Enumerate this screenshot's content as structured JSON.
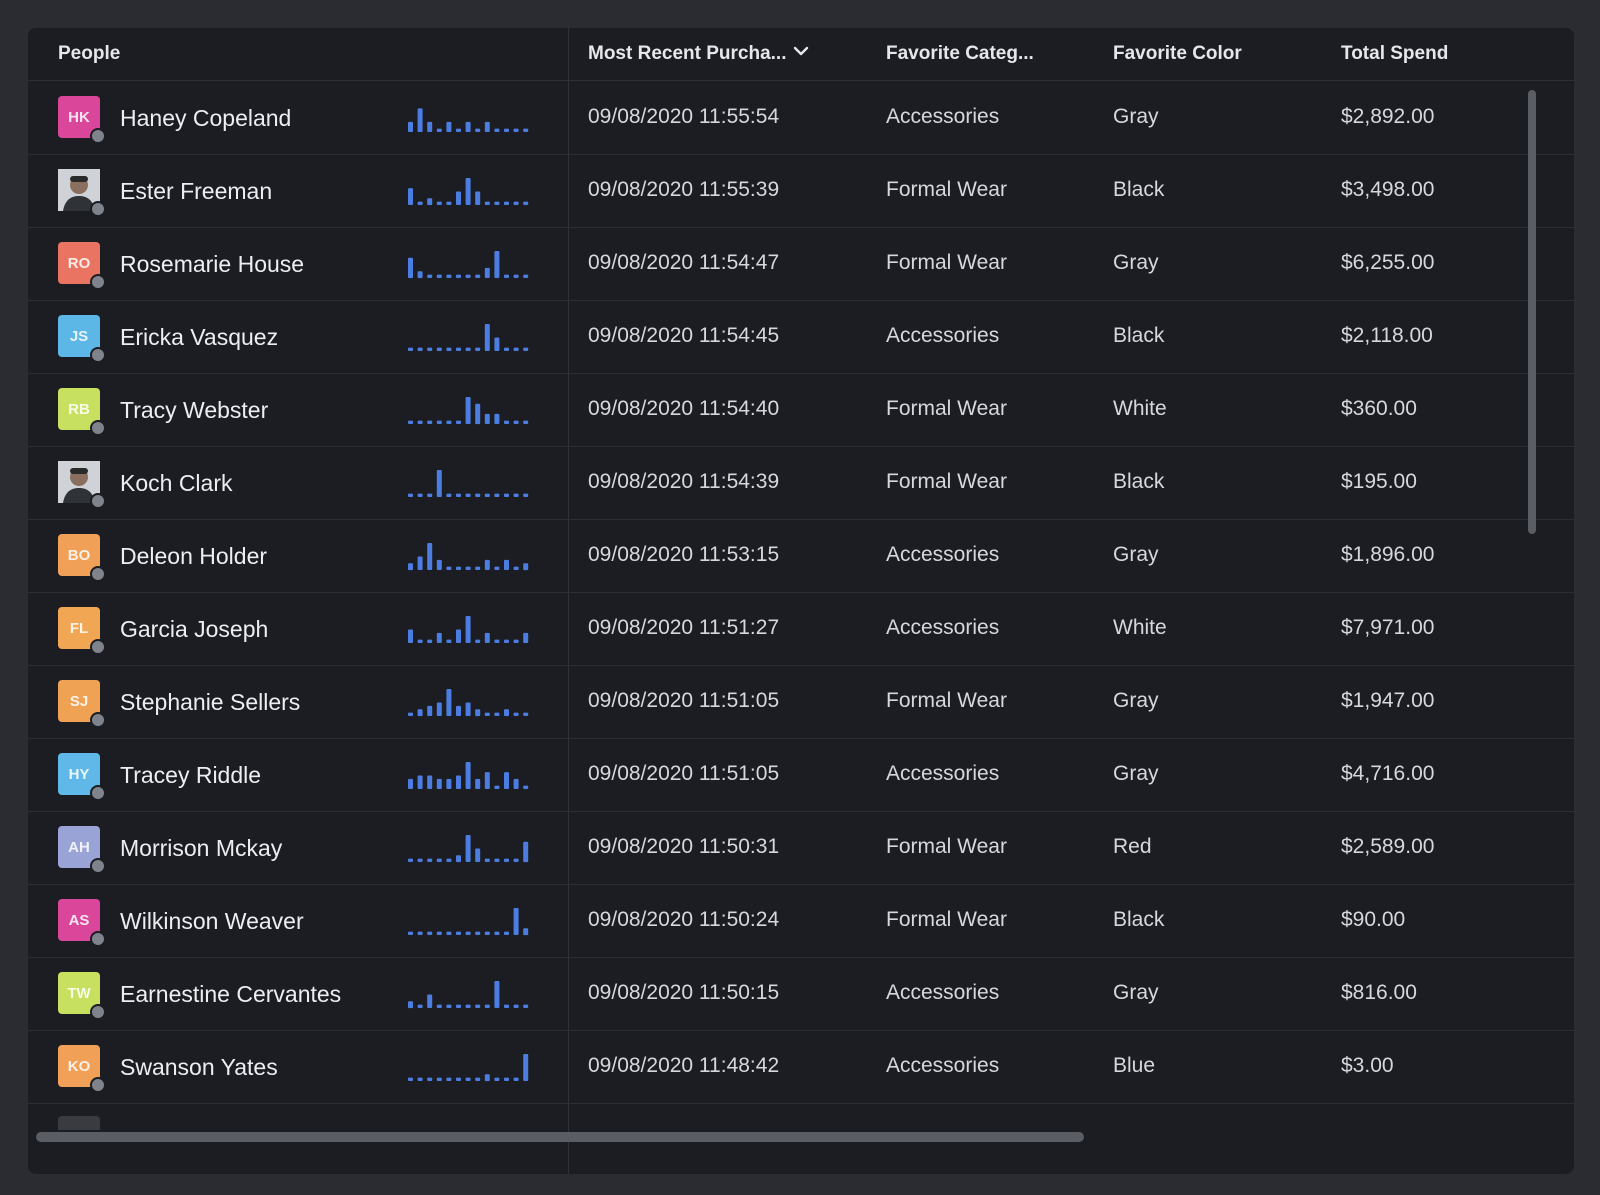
{
  "header": {
    "people": "People",
    "recent": "Most Recent Purcha...",
    "category": "Favorite Categ...",
    "color": "Favorite Color",
    "spend": "Total Spend"
  },
  "colors": {
    "background": "#2b2c31",
    "grid": "#1c1d22",
    "sparkline": "#4c7de0",
    "presence": "#7f848c"
  },
  "rows": [
    {
      "initials": "HK",
      "avatar_color": "#d9469a",
      "photo": false,
      "name": "Haney Copeland",
      "date": "09/08/2020 11:55:54",
      "category": "Accessories",
      "color": "Gray",
      "spend": "$2,892.00",
      "spark": [
        3,
        7,
        3,
        1,
        3,
        1,
        3,
        1,
        3,
        1,
        1,
        1,
        1
      ]
    },
    {
      "initials": "",
      "avatar_color": "#3a3d44",
      "photo": true,
      "name": "Ester Freeman",
      "date": "09/08/2020 11:55:39",
      "category": "Formal Wear",
      "color": "Black",
      "spend": "$3,498.00",
      "spark": [
        5,
        1,
        2,
        1,
        1,
        4,
        8,
        4,
        1,
        1,
        1,
        1,
        1
      ]
    },
    {
      "initials": "RO",
      "avatar_color": "#ea7462",
      "photo": false,
      "name": "Rosemarie House",
      "date": "09/08/2020 11:54:47",
      "category": "Formal Wear",
      "color": "Gray",
      "spend": "$6,255.00",
      "spark": [
        6,
        2,
        1,
        1,
        1,
        1,
        1,
        1,
        3,
        8,
        1,
        1,
        1
      ]
    },
    {
      "initials": "JS",
      "avatar_color": "#5cb6e6",
      "photo": false,
      "name": "Ericka Vasquez",
      "date": "09/08/2020 11:54:45",
      "category": "Accessories",
      "color": "Black",
      "spend": "$2,118.00",
      "spark": [
        1,
        1,
        1,
        1,
        1,
        1,
        1,
        1,
        8,
        4,
        1,
        1,
        1
      ]
    },
    {
      "initials": "RB",
      "avatar_color": "#c7e060",
      "photo": false,
      "name": "Tracy Webster",
      "date": "09/08/2020 11:54:40",
      "category": "Formal Wear",
      "color": "White",
      "spend": "$360.00",
      "spark": [
        1,
        1,
        1,
        1,
        1,
        1,
        8,
        6,
        3,
        3,
        1,
        1,
        1
      ]
    },
    {
      "initials": "",
      "avatar_color": "#3a3d44",
      "photo": true,
      "name": "Koch Clark",
      "date": "09/08/2020 11:54:39",
      "category": "Formal Wear",
      "color": "Black",
      "spend": "$195.00",
      "spark": [
        1,
        1,
        1,
        8,
        1,
        1,
        1,
        1,
        1,
        1,
        1,
        1,
        1
      ]
    },
    {
      "initials": "BO",
      "avatar_color": "#f0a057",
      "photo": false,
      "name": "Deleon Holder",
      "date": "09/08/2020 11:53:15",
      "category": "Accessories",
      "color": "Gray",
      "spend": "$1,896.00",
      "spark": [
        2,
        4,
        8,
        3,
        1,
        1,
        1,
        1,
        3,
        1,
        3,
        1,
        2
      ]
    },
    {
      "initials": "FL",
      "avatar_color": "#f1a653",
      "photo": false,
      "name": "Garcia Joseph",
      "date": "09/08/2020 11:51:27",
      "category": "Accessories",
      "color": "White",
      "spend": "$7,971.00",
      "spark": [
        4,
        1,
        1,
        3,
        1,
        4,
        8,
        1,
        3,
        1,
        1,
        1,
        3
      ]
    },
    {
      "initials": "SJ",
      "avatar_color": "#f0a254",
      "photo": false,
      "name": "Stephanie Sellers",
      "date": "09/08/2020 11:51:05",
      "category": "Formal Wear",
      "color": "Gray",
      "spend": "$1,947.00",
      "spark": [
        1,
        2,
        3,
        4,
        8,
        3,
        4,
        2,
        1,
        1,
        2,
        1,
        1
      ]
    },
    {
      "initials": "HY",
      "avatar_color": "#5fb8e8",
      "photo": false,
      "name": "Tracey Riddle",
      "date": "09/08/2020 11:51:05",
      "category": "Accessories",
      "color": "Gray",
      "spend": "$4,716.00",
      "spark": [
        3,
        4,
        4,
        3,
        3,
        4,
        8,
        3,
        5,
        1,
        5,
        3,
        1
      ]
    },
    {
      "initials": "AH",
      "avatar_color": "#9aa3d6",
      "photo": false,
      "name": "Morrison Mckay",
      "date": "09/08/2020 11:50:31",
      "category": "Formal Wear",
      "color": "Red",
      "spend": "$2,589.00",
      "spark": [
        1,
        1,
        1,
        1,
        1,
        2,
        8,
        4,
        1,
        1,
        1,
        1,
        6
      ]
    },
    {
      "initials": "AS",
      "avatar_color": "#d9469a",
      "photo": false,
      "name": "Wilkinson Weaver",
      "date": "09/08/2020 11:50:24",
      "category": "Formal Wear",
      "color": "Black",
      "spend": "$90.00",
      "spark": [
        1,
        1,
        1,
        1,
        1,
        1,
        1,
        1,
        1,
        1,
        1,
        8,
        2
      ]
    },
    {
      "initials": "TW",
      "avatar_color": "#c7e060",
      "photo": false,
      "name": "Earnestine Cervantes",
      "date": "09/08/2020 11:50:15",
      "category": "Accessories",
      "color": "Gray",
      "spend": "$816.00",
      "spark": [
        2,
        1,
        4,
        1,
        1,
        1,
        1,
        1,
        1,
        8,
        1,
        1,
        1
      ]
    },
    {
      "initials": "KO",
      "avatar_color": "#f0a057",
      "photo": false,
      "name": "Swanson Yates",
      "date": "09/08/2020 11:48:42",
      "category": "Accessories",
      "color": "Blue",
      "spend": "$3.00",
      "spark": [
        1,
        1,
        1,
        1,
        1,
        1,
        1,
        1,
        2,
        1,
        1,
        1,
        8
      ]
    }
  ]
}
